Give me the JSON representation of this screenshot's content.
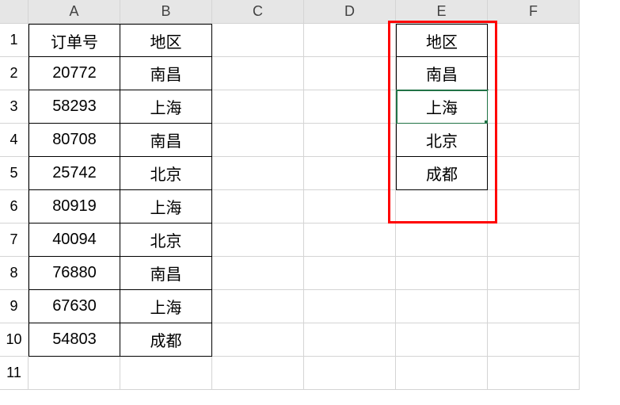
{
  "columns": [
    "A",
    "B",
    "C",
    "D",
    "E",
    "F"
  ],
  "row_count": 11,
  "cells": {
    "A1": "订单号",
    "B1": "地区",
    "A2": "20772",
    "B2": "南昌",
    "A3": "58293",
    "B3": "上海",
    "A4": "80708",
    "B4": "南昌",
    "A5": "25742",
    "B5": "北京",
    "A6": "80919",
    "B6": "上海",
    "A7": "40094",
    "B7": "北京",
    "A8": "76880",
    "B8": "南昌",
    "A9": "67630",
    "B9": "上海",
    "A10": "54803",
    "B10": "成都",
    "E1": "地区",
    "E2": "南昌",
    "E3": "上海",
    "E4": "北京",
    "E5": "成都"
  },
  "selected_cell": "E3",
  "highlight_box": {
    "col_start": "E",
    "col_end": "E",
    "row_start": 0,
    "row_end": 6
  },
  "chart_data": {
    "type": "table",
    "tables": [
      {
        "name": "orders",
        "columns": [
          "订单号",
          "地区"
        ],
        "rows": [
          [
            "20772",
            "南昌"
          ],
          [
            "58293",
            "上海"
          ],
          [
            "80708",
            "南昌"
          ],
          [
            "25742",
            "北京"
          ],
          [
            "80919",
            "上海"
          ],
          [
            "40094",
            "北京"
          ],
          [
            "76880",
            "南昌"
          ],
          [
            "67630",
            "上海"
          ],
          [
            "54803",
            "成都"
          ]
        ]
      },
      {
        "name": "unique_regions",
        "columns": [
          "地区"
        ],
        "rows": [
          [
            "南昌"
          ],
          [
            "上海"
          ],
          [
            "北京"
          ],
          [
            "成都"
          ]
        ]
      }
    ]
  }
}
